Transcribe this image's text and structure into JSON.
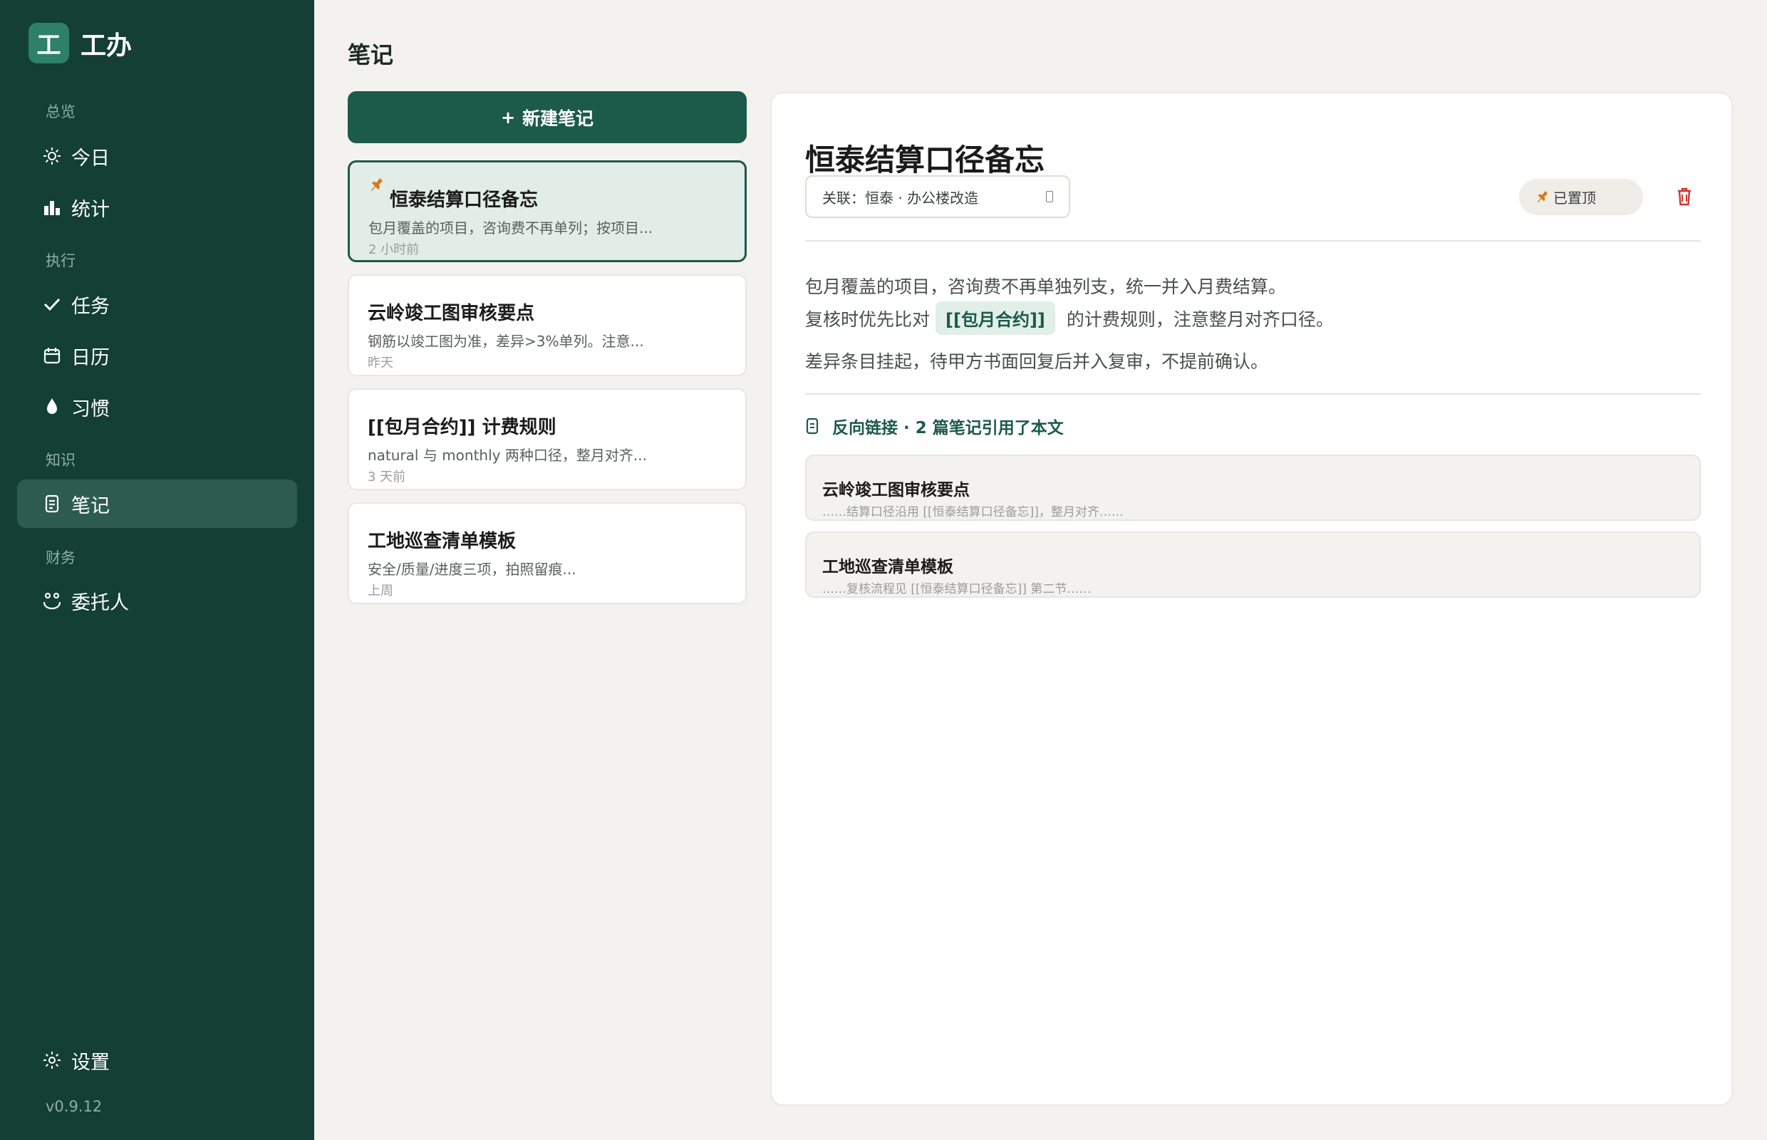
{
  "app": {
    "logo_mark": "工",
    "name": "工办",
    "version": "v0.9.12"
  },
  "sidebar": {
    "sections": [
      {
        "label": "总览"
      },
      {
        "label": "执行"
      },
      {
        "label": "知识"
      },
      {
        "label": "财务"
      }
    ],
    "items": [
      {
        "label": "今日",
        "icon": "sun-icon"
      },
      {
        "label": "统计",
        "icon": "bar-chart-icon"
      },
      {
        "label": "任务",
        "icon": "check-icon"
      },
      {
        "label": "日历",
        "icon": "calendar-icon"
      },
      {
        "label": "习惯",
        "icon": "drop-icon"
      },
      {
        "label": "笔记",
        "icon": "note-icon",
        "active": true
      },
      {
        "label": "委托人",
        "icon": "people-icon"
      },
      {
        "label": "设置",
        "icon": "gear-icon"
      }
    ]
  },
  "page": {
    "title": "笔记"
  },
  "new_note": {
    "plus": "+",
    "label": "新建笔记"
  },
  "notes": [
    {
      "title": "恒泰结算口径备忘",
      "preview": "包月覆盖的项目，咨询费不再单列；按项目...",
      "time": "2 小时前",
      "pinned": true,
      "active": true
    },
    {
      "title": "云岭竣工图审核要点",
      "preview": "钢筋以竣工图为准，差异>3%单列。注意...",
      "time": "昨天"
    },
    {
      "title": "[[包月合约]] 计费规则",
      "preview": "natural 与 monthly 两种口径，整月对齐...",
      "time": "3 天前"
    },
    {
      "title": "工地巡查清单模板",
      "preview": "安全/质量/进度三项，拍照留痕...",
      "time": "上周"
    }
  ],
  "detail": {
    "title": "恒泰结算口径备忘",
    "link_select": "关联：恒泰 · 办公楼改造",
    "pin_label": "已置顶",
    "body": {
      "line1": "包月覆盖的项目，咨询费不再单独列支，统一并入月费结算。",
      "line2_before": "复核时优先比对",
      "line2_link": "[[包月合约]]",
      "line2_after": "的计费规则，注意整月对齐口径。",
      "line3": "差异条目挂起，待甲方书面回复后并入复审，不提前确认。"
    },
    "backlinks_heading": "反向链接 · 2 篇笔记引用了本文",
    "backlinks": [
      {
        "title": "云岭竣工图审核要点",
        "snippet": "……结算口径沿用 [[恒泰结算口径备忘]]，整月对齐……"
      },
      {
        "title": "工地巡查清单模板",
        "snippet": "……复核流程见 [[恒泰结算口径备忘]] 第二节……"
      }
    ]
  },
  "colors": {
    "sidebar_bg": "#133f34",
    "accent": "#1c5a4a",
    "pin": "#d67a1e",
    "delete": "#d0342c",
    "page_bg": "#f3f2ee"
  }
}
